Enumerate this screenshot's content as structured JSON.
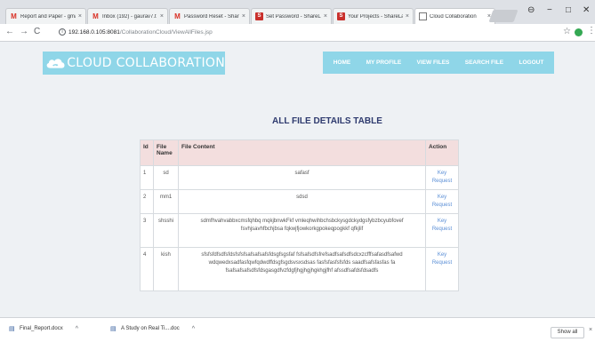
{
  "browser": {
    "tabs": [
      {
        "label": "Report and Paper - gma",
        "favicon": "gmail"
      },
      {
        "label": "Inbox (192) - gaurav7.t",
        "favicon": "gmail"
      },
      {
        "label": "Password Reset - Share",
        "favicon": "gmail"
      },
      {
        "label": "Set Password - ShareLa",
        "favicon": "sharelatex"
      },
      {
        "label": "Your Projects - ShareLa",
        "favicon": "sharelatex"
      },
      {
        "label": "Cloud Collaboration",
        "favicon": "document"
      }
    ],
    "tab_close_glyph": "×",
    "url_host": "192.168.0.105:8081",
    "url_path": "/CollaborationCloud/ViewAllFiles.jsp",
    "window_controls": {
      "profile": "⊖",
      "minimize": "−",
      "maximize": "□",
      "close": "✕"
    }
  },
  "site": {
    "logo_text": "CLOUD COLLABORATION",
    "nav": [
      "HOME",
      "MY PROFILE",
      "VIEW FILES",
      "SEARCH FILE",
      "LOGOUT"
    ],
    "heading": "ALL FILE DETAILS TABLE"
  },
  "table": {
    "headers": {
      "id": "Id",
      "name": "File Name",
      "content": "File Content",
      "action": "Action"
    },
    "rows": [
      {
        "id": "1",
        "name": "sd",
        "content": "safasf",
        "action": "Key Request"
      },
      {
        "id": "2",
        "name": "mm1",
        "content": "sdsd",
        "action": "Key Request"
      },
      {
        "id": "3",
        "name": "shsshi",
        "content": "sdmfhvahvabbxcmsfqhbq mqkjbnwkFkf vmleqhwihbchsbckysgdckydgsfybzbcyubfovef fsvhjsavhfbchjbsa fqkwjfjowkorkgpokeqpogkkf qfkjlif",
        "action": "Key Request"
      },
      {
        "id": "4",
        "name": "kish",
        "content": "sfsfsfdfsdfsfdsfsfsfsafsafsafsfdsgfsgsfaf fsfsafsdfsfrefsadfsafsdfsdcxzcfffsafasdfsafwd wdqwedxsadfasfqwfqdwdffdsgfsgdsvsxsdsas fasfsfasfsfsfds saadfsafsfasfas fa fsafsafsafsdfsfdsgasgdfvzfdgfjhgjhgjhgkhgjfhf afssdfsafdsfdsadfs",
        "action": "Key Request"
      }
    ]
  },
  "downloads": {
    "items": [
      {
        "label": "Final_Report.docx"
      },
      {
        "label": "A Study on Real Ti....doc"
      }
    ],
    "show_all": "Show all",
    "close_glyph": "×"
  }
}
